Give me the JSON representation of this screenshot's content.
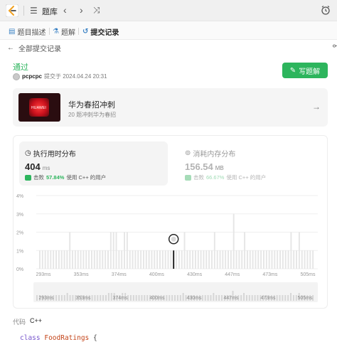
{
  "topbar": {
    "title": "题库",
    "prev_icon": "chevron-left-icon",
    "next_icon": "chevron-right-icon",
    "shuffle_icon": "shuffle-icon"
  },
  "tabs": [
    {
      "label": "题目描述",
      "icon": "document-icon",
      "active": false
    },
    {
      "label": "题解",
      "icon": "flask-icon",
      "active": false
    },
    {
      "label": "提交记录",
      "icon": "history-icon",
      "active": true
    }
  ],
  "back": {
    "label": "全部提交记录"
  },
  "submission": {
    "status": "通过",
    "user": "pcpcpc",
    "submitted_text": "提交于 2024.04.24 20:31",
    "write_solution_label": "写题解"
  },
  "plan": {
    "title": "华为春招冲刺",
    "subtitle": "20 题冲刺华为春招",
    "logo_text": "HUAWEI"
  },
  "runtime": {
    "heading": "执行用时分布",
    "value": "404",
    "unit": "ms",
    "beat_prefix": "击败",
    "beat_pct": "57.84%",
    "beat_suffix": "使用 C++ 的用户"
  },
  "memory": {
    "heading": "消耗内存分布",
    "value": "156.54",
    "unit": "MB",
    "beat_prefix": "击败",
    "beat_pct": "66.67%",
    "beat_suffix": "使用 C++ 的用户"
  },
  "chart_data": {
    "type": "bar",
    "title": "",
    "xlabel": "",
    "ylabel": "",
    "ylim": [
      0,
      4
    ],
    "y_ticks": [
      "0%",
      "1%",
      "2%",
      "3%",
      "4%"
    ],
    "x_tick_labels": [
      "293ms",
      "353ms",
      "374ms",
      "400ms",
      "430ms",
      "447ms",
      "473ms",
      "505ms"
    ],
    "overview_tick_labels": [
      "293ms",
      "353ms",
      "374ms",
      "400ms",
      "430ms",
      "447ms",
      "473ms",
      "505ms"
    ],
    "values": [
      1,
      1,
      1,
      1,
      1,
      1,
      1,
      1,
      1,
      1,
      1,
      2,
      1,
      1,
      1,
      1,
      1,
      1,
      1,
      1,
      1,
      1,
      1,
      1,
      1,
      1,
      2,
      2,
      2,
      1,
      1,
      2,
      2,
      1,
      1,
      1,
      1,
      1,
      1,
      1,
      1,
      1,
      1,
      1,
      1,
      1,
      1,
      1,
      1,
      1,
      1,
      1,
      1,
      2,
      1,
      1,
      1,
      1,
      1,
      1,
      1,
      1,
      1,
      1,
      2,
      1,
      1,
      1,
      1,
      1,
      1,
      3,
      1,
      1,
      1,
      2,
      1,
      1,
      1,
      1,
      1,
      1,
      1,
      1,
      1,
      1,
      1,
      1,
      1,
      1,
      1,
      1,
      2,
      1,
      1,
      2,
      1,
      1,
      1,
      1,
      1
    ],
    "highlight_index": 49,
    "grid": true
  },
  "code": {
    "label": "代码",
    "language": "C++",
    "first_line_keyword": "class",
    "first_line_name": "FoodRatings",
    "first_line_rest": " {"
  },
  "colors": {
    "accent_green": "#2db55d",
    "bar_gray": "#e6e6e6",
    "highlight_bar": "#1a1a1a"
  }
}
